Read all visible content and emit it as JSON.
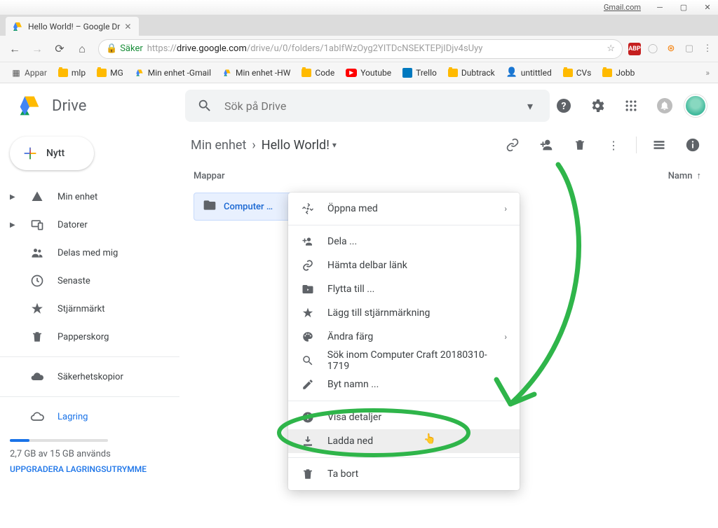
{
  "window": {
    "gmail": "Gmail.com"
  },
  "tab": {
    "title": "Hello World! – Google Dr"
  },
  "url": {
    "secure_label": "Säker",
    "host": "drive.google.com",
    "prefix": "https://",
    "path": "/drive/u/0/folders/1abIfWzOyg2YITDcNSEKTEPjIDjv4sUyy"
  },
  "bookmarks": {
    "apps": "Appar",
    "items": [
      "mlp",
      "MG",
      "Min enhet -Gmail",
      "Min enhet -HW",
      "Code",
      "Youtube",
      "Trello",
      "Dubtrack",
      "untittled",
      "CVs",
      "Jobb"
    ]
  },
  "drive": {
    "brand": "Drive",
    "search_placeholder": "Sök på Drive",
    "new_button": "Nytt"
  },
  "sidebar": {
    "items": [
      {
        "label": "Min enhet",
        "icon": "drive"
      },
      {
        "label": "Datorer",
        "icon": "devices"
      },
      {
        "label": "Delas med mig",
        "icon": "people"
      },
      {
        "label": "Senaste",
        "icon": "clock"
      },
      {
        "label": "Stjärnmärkt",
        "icon": "star"
      },
      {
        "label": "Papperskorg",
        "icon": "trash"
      }
    ],
    "backups": "Säkerhetskopior",
    "storage_label": "Lagring",
    "storage_used": "2,7 GB av 15 GB används",
    "storage_upgrade": "UPPGRADERA LAGRINGSUTRYMME"
  },
  "breadcrumb": {
    "root": "Min enhet",
    "current": "Hello World!"
  },
  "list": {
    "section": "Mappar",
    "sort": "Namn",
    "folder": "Computer …"
  },
  "context_menu": {
    "open_with": "Öppna med",
    "share": "Dela ...",
    "get_link": "Hämta delbar länk",
    "move_to": "Flytta till ...",
    "star": "Lägg till stjärnmärkning",
    "color": "Ändra färg",
    "search_in": "Sök inom Computer Craft 20180310-1719",
    "rename": "Byt namn ...",
    "details": "Visa detaljer",
    "download": "Ladda ned",
    "delete": "Ta bort"
  }
}
